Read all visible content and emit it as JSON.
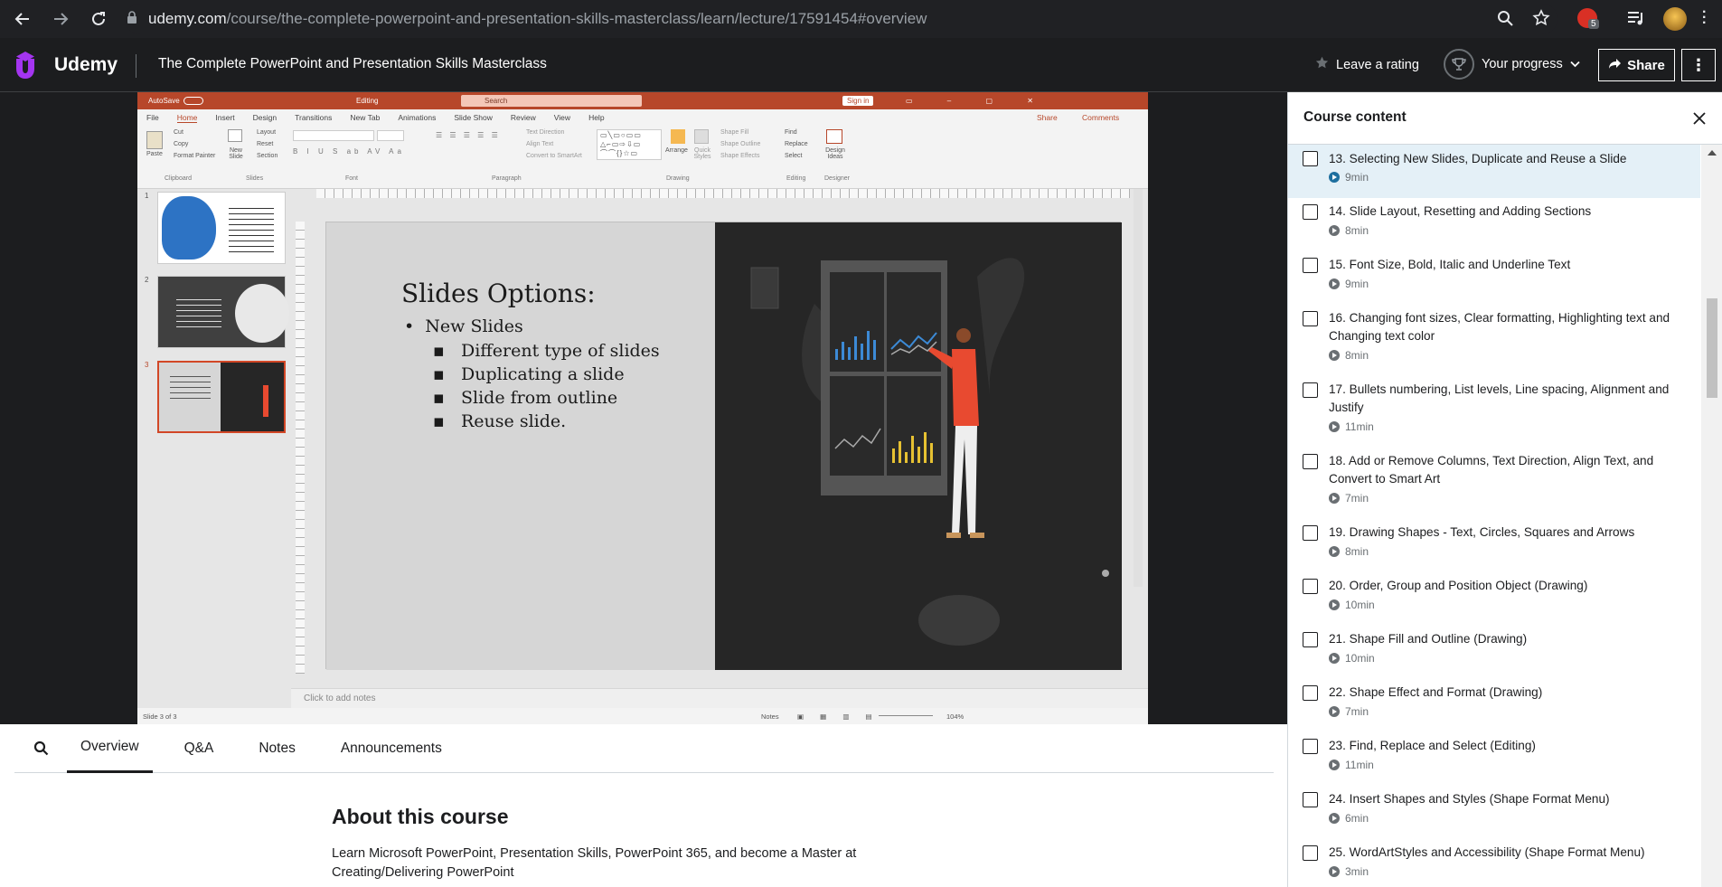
{
  "browser": {
    "url_host": "udemy.com",
    "url_path": "/course/the-complete-powerpoint-and-presentation-skills-masterclass/learn/lecture/17591454#overview",
    "extension_badge": "5"
  },
  "header": {
    "logo_text": "Udemy",
    "course_title": "The Complete PowerPoint and Presentation Skills Masterclass",
    "leave_rating": "Leave a rating",
    "progress_label": "Your progress",
    "share_label": "Share"
  },
  "ppt": {
    "autosave": "AutoSave",
    "file_name": "Editing",
    "search_placeholder": "Search",
    "sign_in": "Sign in",
    "menu": [
      "File",
      "Home",
      "Insert",
      "Design",
      "Transitions",
      "New Tab",
      "Animations",
      "Slide Show",
      "Review",
      "View",
      "Help"
    ],
    "share": "Share",
    "comments": "Comments",
    "ribbon_groups": [
      "Clipboard",
      "Slides",
      "Font",
      "Paragraph",
      "Drawing",
      "Editing",
      "Designer"
    ],
    "ribbon_items": {
      "paste": "Paste",
      "cut": "Cut",
      "copy": "Copy",
      "format_painter": "Format Painter",
      "new_slide": "New Slide",
      "layout": "Layout",
      "reset": "Reset",
      "section": "Section",
      "text_direction": "Text Direction",
      "align_text": "Align Text",
      "convert_smartart": "Convert to SmartArt",
      "arrange": "Arrange",
      "quick_styles": "Quick Styles",
      "shape_fill": "Shape Fill",
      "shape_outline": "Shape Outline",
      "shape_effects": "Shape Effects",
      "find": "Find",
      "replace": "Replace",
      "select": "Select",
      "design_ideas": "Design Ideas"
    },
    "thumb_numbers": [
      "1",
      "2",
      "3"
    ],
    "slide": {
      "heading": "Slides Options:",
      "bullet_main": "New Slides",
      "sub_bullets": [
        "Different type of slides",
        "Duplicating a slide",
        "Slide from outline",
        "Reuse slide."
      ]
    },
    "notes_placeholder": "Click to add notes",
    "status_slide": "Slide 3 of 3",
    "status_notes": "Notes",
    "zoom": "104%"
  },
  "tabs": {
    "items": [
      "Overview",
      "Q&A",
      "Notes",
      "Announcements"
    ],
    "active": "Overview"
  },
  "about": {
    "title": "About this course",
    "text": "Learn Microsoft PowerPoint, Presentation Skills, PowerPoint 365, and become a Master at Creating/Delivering PowerPoint"
  },
  "sidebar": {
    "title": "Course content",
    "lectures": [
      {
        "title": "13. Selecting New Slides, Duplicate and Reuse a Slide",
        "duration": "9min",
        "active": true
      },
      {
        "title": "14. Slide Layout, Resetting and Adding Sections",
        "duration": "8min"
      },
      {
        "title": "15. Font Size, Bold, Italic and Underline Text",
        "duration": "9min"
      },
      {
        "title": "16. Changing font sizes, Clear formatting, Highlighting text and Changing text color",
        "duration": "8min"
      },
      {
        "title": "17. Bullets numbering, List levels, Line spacing, Alignment and Justify",
        "duration": "11min"
      },
      {
        "title": "18. Add or Remove Columns, Text Direction, Align Text, and Convert to Smart Art",
        "duration": "7min"
      },
      {
        "title": "19. Drawing Shapes - Text, Circles, Squares and Arrows",
        "duration": "8min"
      },
      {
        "title": "20. Order, Group and Position Object (Drawing)",
        "duration": "10min"
      },
      {
        "title": "21. Shape Fill and Outline (Drawing)",
        "duration": "10min"
      },
      {
        "title": "22. Shape Effect and Format (Drawing)",
        "duration": "7min"
      },
      {
        "title": "23. Find, Replace and Select (Editing)",
        "duration": "11min"
      },
      {
        "title": "24. Insert Shapes and Styles (Shape Format Menu)",
        "duration": "6min"
      },
      {
        "title": "25. WordArtStyles and Accessibility (Shape Format Menu)",
        "duration": "3min"
      }
    ]
  },
  "colors": {
    "udemy_brand": "#a435f0",
    "header_bg": "#1c1d1f",
    "ppt_accent": "#b7472a",
    "active_lecture_bg": "#e4f0f7"
  }
}
